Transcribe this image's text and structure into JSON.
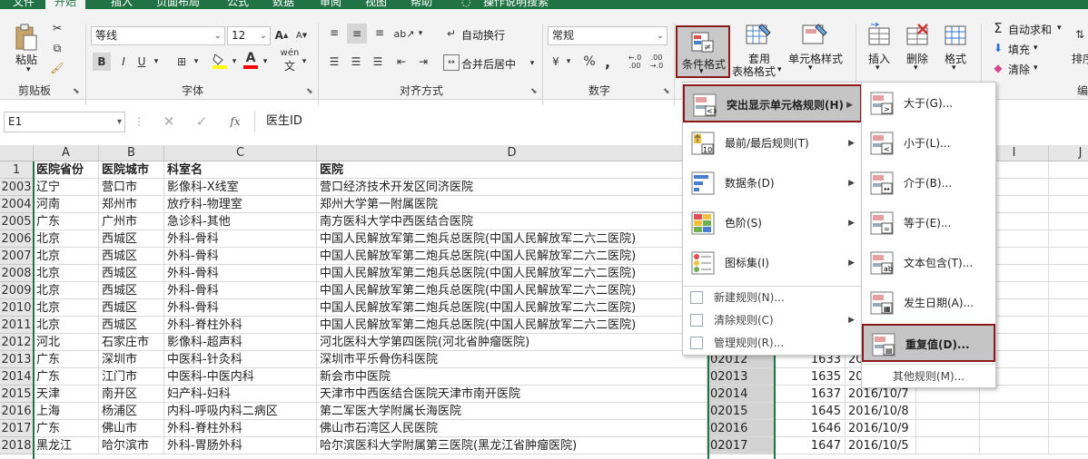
{
  "tabs": [
    "文件",
    "开始",
    "插入",
    "页面布局",
    "公式",
    "数据",
    "审阅",
    "视图",
    "帮助",
    "操作说明搜索"
  ],
  "ribbon": {
    "clipboard": {
      "paste_label": "粘贴",
      "group_label": "剪贴板"
    },
    "font": {
      "font_name": "等线",
      "font_size": "12",
      "bold": "B",
      "italic": "I",
      "underline": "U",
      "grow": "A",
      "shrink": "A",
      "font_color": "A",
      "wen": "wén",
      "group_label": "字体"
    },
    "alignment": {
      "wrap_label": "自动换行",
      "merge_label": "合并后居中",
      "group_label": "对齐方式"
    },
    "number": {
      "format": "常规",
      "currency": "¥",
      "percent": "%",
      "comma": ",",
      "inc_dec": "←.0 .00",
      "dec_dec": ".00 →.0",
      "group_label": "数字"
    },
    "styles": {
      "cond_format_label": "条件格式",
      "table_label_1": "套用",
      "table_label_2": "表格格式",
      "cell_styles_label": "单元格样式"
    },
    "cells": {
      "insert_label": "插入",
      "delete_label": "删除",
      "format_label": "格式"
    },
    "editing": {
      "autosum_label": "自动求和",
      "fill_label": "填充",
      "clear_label": "清除",
      "sort_label": "排序",
      "group_label": "编"
    }
  },
  "formula_bar": {
    "name_box": "E1",
    "fx": "fx",
    "value": "医生ID"
  },
  "columns": [
    "A",
    "B",
    "C",
    "D",
    "E",
    "F",
    "G",
    "H",
    "I",
    "J"
  ],
  "rows": [
    {
      "num": "1",
      "a": "医院省份",
      "b": "医院城市",
      "c": "科室名",
      "d": "医院",
      "e": "",
      "f": "",
      "g": ""
    },
    {
      "num": "2003",
      "a": "辽宁",
      "b": "营口市",
      "c": "影像科-X线室",
      "d": "营口经济技术开发区同济医院",
      "e": "",
      "f": "",
      "g": ""
    },
    {
      "num": "2004",
      "a": "河南",
      "b": "郑州市",
      "c": "放疗科-物理室",
      "d": "郑州大学第一附属医院",
      "e": "",
      "f": "",
      "g": ""
    },
    {
      "num": "2005",
      "a": "广东",
      "b": "广州市",
      "c": "急诊科-其他",
      "d": "南方医科大学中西医结合医院",
      "e": "",
      "f": "",
      "g": ""
    },
    {
      "num": "2006",
      "a": "北京",
      "b": "西城区",
      "c": "外科-骨科",
      "d": "中国人民解放军第二炮兵总医院(中国人民解放军二六二医院)",
      "e": "",
      "f": "",
      "g": ""
    },
    {
      "num": "2007",
      "a": "北京",
      "b": "西城区",
      "c": "外科-骨科",
      "d": "中国人民解放军第二炮兵总医院(中国人民解放军二六二医院)",
      "e": "",
      "f": "",
      "g": ""
    },
    {
      "num": "2008",
      "a": "北京",
      "b": "西城区",
      "c": "外科-骨科",
      "d": "中国人民解放军第二炮兵总医院(中国人民解放军二六二医院)",
      "e": "",
      "f": "",
      "g": ""
    },
    {
      "num": "2009",
      "a": "北京",
      "b": "西城区",
      "c": "外科-骨科",
      "d": "中国人民解放军第二炮兵总医院(中国人民解放军二六二医院)",
      "e": "",
      "f": "",
      "g": ""
    },
    {
      "num": "2010",
      "a": "北京",
      "b": "西城区",
      "c": "外科-骨科",
      "d": "中国人民解放军第二炮兵总医院(中国人民解放军二六二医院)",
      "e": "",
      "f": "",
      "g": ""
    },
    {
      "num": "2011",
      "a": "北京",
      "b": "西城区",
      "c": "外科-脊柱外科",
      "d": "中国人民解放军第二炮兵总医院(中国人民解放军二六二医院)",
      "e": "",
      "f": "",
      "g": ""
    },
    {
      "num": "2012",
      "a": "河北",
      "b": "石家庄市",
      "c": "影像科-超声科",
      "d": "河北医科大学第四医院(河北省肿瘤医院)",
      "e": "",
      "f": "",
      "g": ""
    },
    {
      "num": "2013",
      "a": "广东",
      "b": "深圳市",
      "c": "中医科-针灸科",
      "d": "深圳市平乐骨伤科医院",
      "e": "02012",
      "f": "1633",
      "g": "20"
    },
    {
      "num": "2014",
      "a": "广东",
      "b": "江门市",
      "c": "中医科-中医内科",
      "d": "新会市中医院",
      "e": "02013",
      "f": "1635",
      "g": "20"
    },
    {
      "num": "2015",
      "a": "天津",
      "b": "南开区",
      "c": "妇产科-妇科",
      "d": "天津市中西医结合医院天津市南开医院",
      "e": "02014",
      "f": "1637",
      "g": "2016/10/7"
    },
    {
      "num": "2016",
      "a": "上海",
      "b": "杨浦区",
      "c": "内科-呼吸内科二病区",
      "d": "第二军医大学附属长海医院",
      "e": "02015",
      "f": "1645",
      "g": "2016/10/8"
    },
    {
      "num": "2017",
      "a": "广东",
      "b": "佛山市",
      "c": "外科-脊柱外科",
      "d": "佛山市石湾区人民医院",
      "e": "02016",
      "f": "1646",
      "g": "2016/10/9"
    },
    {
      "num": "2018",
      "a": "黑龙江",
      "b": "哈尔滨市",
      "c": "外科-胃肠外科",
      "d": "哈尔滨医科大学附属第三医院(黑龙江省肿瘤医院)",
      "e": "02017",
      "f": "1647",
      "g": "2016/10/5"
    }
  ],
  "cond_menu": {
    "items": [
      {
        "label": "突出显示单元格规则(H)",
        "highlight": true
      },
      {
        "label": "最前/最后规则(T)"
      },
      {
        "label": "数据条(D)"
      },
      {
        "label": "色阶(S)"
      },
      {
        "label": "图标集(I)"
      }
    ],
    "small_items": [
      "新建规则(N)...",
      "清除规则(C)",
      "管理规则(R)..."
    ]
  },
  "sub_menu": {
    "items": [
      "大于(G)...",
      "小于(L)...",
      "介于(B)...",
      "等于(E)...",
      "文本包含(T)...",
      "发生日期(A)...",
      "重复值(D)..."
    ],
    "more": "其他规则(M)..."
  },
  "colors": {
    "accent": "#217346",
    "highlight_border": "#8b1a1a",
    "menu_highlight": "#c5c5c5",
    "header_bg": "#e6e6e6"
  }
}
